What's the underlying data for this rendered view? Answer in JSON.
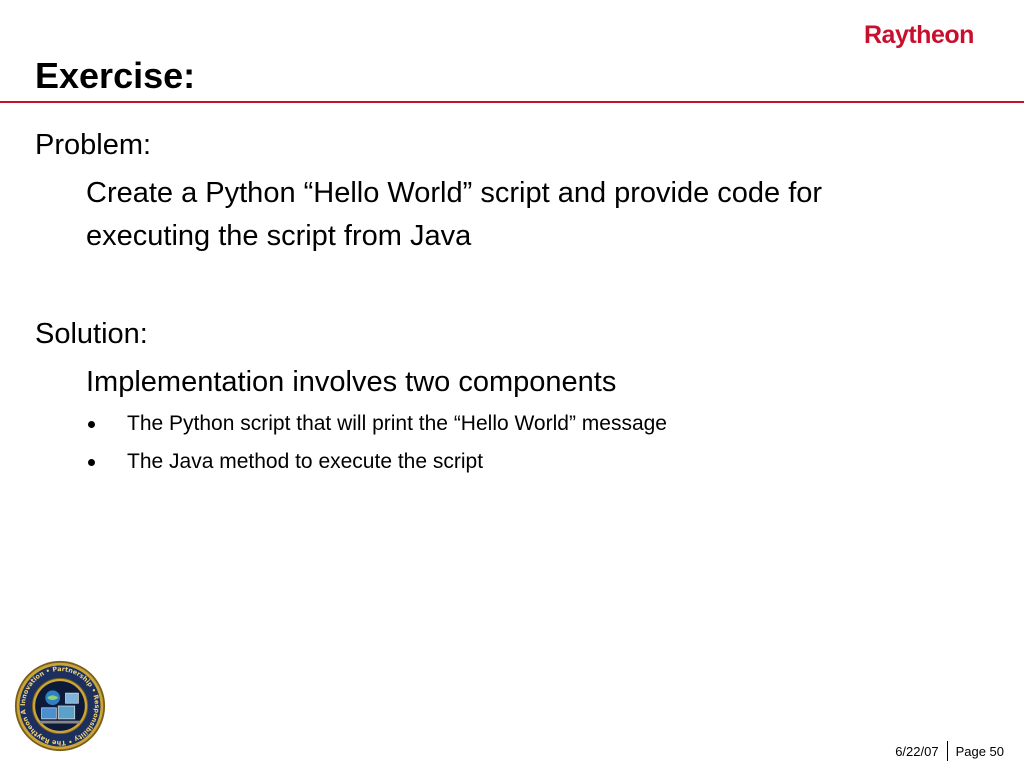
{
  "header": {
    "logo_text": "Raytheon",
    "title": "Exercise:"
  },
  "body": {
    "problem_heading": "Problem:",
    "problem_lines": [
      "Create a Python “Hello World” script and provide code for",
      "executing the script from Java"
    ],
    "solution_heading": "Solution:",
    "solution_intro": "Implementation involves two components",
    "bullets": [
      "The Python script that will print the “Hello World” message",
      "The Java method to execute the script"
    ]
  },
  "seal": {
    "text": "Innovation • Partnership • Responsibility • The Raytheon AWIPS Team"
  },
  "footer": {
    "date": "6/22/07",
    "page": "Page 50"
  },
  "colors": {
    "brand_red": "#c8102e",
    "text": "#000000",
    "seal_gold": "#c9a53a",
    "seal_navy": "#1d2f5e"
  }
}
